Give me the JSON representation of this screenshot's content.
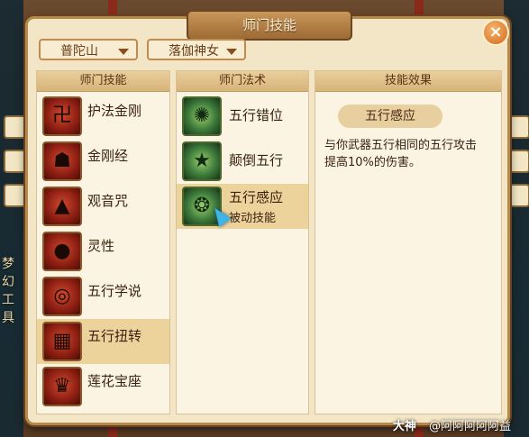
{
  "window": {
    "title": "师门技能",
    "close_icon": "close-icon"
  },
  "dropdowns": {
    "school": "普陀山",
    "role": "落伽神女"
  },
  "columns": {
    "skills_header": "师门技能",
    "spells_header": "师门法术",
    "effect_header": "技能效果"
  },
  "skills": [
    {
      "label": "护法金刚",
      "icon": "vajra-icon"
    },
    {
      "label": "金刚经",
      "icon": "demon-mask-icon"
    },
    {
      "label": "观音咒",
      "icon": "pagoda-icon"
    },
    {
      "label": "灵性",
      "icon": "head-silhouette-icon"
    },
    {
      "label": "五行学说",
      "icon": "circle-sigil-icon"
    },
    {
      "label": "五行扭转",
      "icon": "checker-orb-icon"
    },
    {
      "label": "莲花宝座",
      "icon": "lotus-throne-icon"
    }
  ],
  "selected_skill_index": 5,
  "spells": [
    {
      "label": "五行错位",
      "sub": "",
      "icon": "swirl-ring-icon"
    },
    {
      "label": "颠倒五行",
      "sub": "",
      "icon": "pentagram-icon"
    },
    {
      "label": "五行感应",
      "sub": "被动技能",
      "icon": "orb-ring-icon"
    }
  ],
  "selected_spell_index": 2,
  "effect": {
    "name": "五行感应",
    "description_line1": "与你武器五行相同的五行攻击",
    "description_line2": "提高10%的伤害。"
  },
  "watermark": {
    "brand": "大神",
    "user": "@阿阿阿阿阿益"
  },
  "background_side_labels": [
    "梦",
    "幻",
    "工",
    "具"
  ]
}
